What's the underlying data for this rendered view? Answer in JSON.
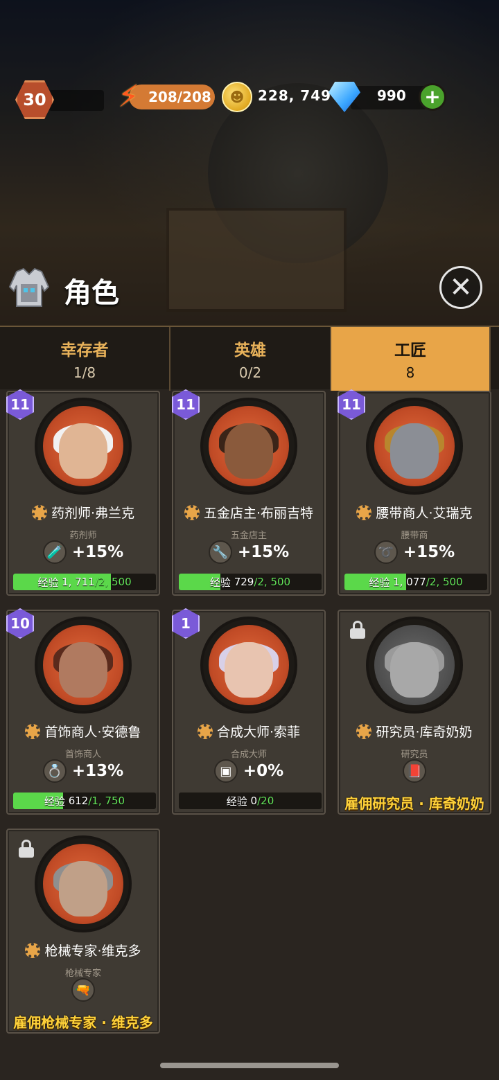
{
  "hud": {
    "player_level": "30",
    "energy": "208/208",
    "coins": "228, 749",
    "gems": "990",
    "add_label": "+"
  },
  "header": {
    "title": "角色",
    "close_label": "✕"
  },
  "tabs": [
    {
      "label": "幸存者",
      "count": "1/8",
      "active": false
    },
    {
      "label": "英雄",
      "count": "0/2",
      "active": false
    },
    {
      "label": "工匠",
      "count": "8",
      "active": true
    }
  ],
  "cards": [
    {
      "level": "11",
      "name": "药剂师·弗兰克",
      "role": "药剂师",
      "bonus": "+15%",
      "bonus_icon": "potion-icon",
      "xp_label": "经验",
      "xp_current": "1, 711",
      "xp_max": "2, 500",
      "xp_progress": 0.684,
      "locked": false
    },
    {
      "level": "11",
      "name": "五金店主·布丽吉特",
      "role": "五金店主",
      "bonus": "+15%",
      "bonus_icon": "wrench-icon",
      "xp_label": "经验",
      "xp_current": "729",
      "xp_max": "2, 500",
      "xp_progress": 0.292,
      "locked": false
    },
    {
      "level": "11",
      "name": "腰带商人·艾瑞克",
      "role": "腰带商",
      "bonus": "+15%",
      "bonus_icon": "belt-icon",
      "xp_label": "经验",
      "xp_current": "1, 077",
      "xp_max": "2, 500",
      "xp_progress": 0.431,
      "locked": false
    },
    {
      "level": "10",
      "name": "首饰商人·安德鲁",
      "role": "首饰商人",
      "bonus": "+13%",
      "bonus_icon": "ring-icon",
      "xp_label": "经验",
      "xp_current": "612",
      "xp_max": "1, 750",
      "xp_progress": 0.35,
      "locked": false
    },
    {
      "level": "1",
      "name": "合成大师·索菲",
      "role": "合成大师",
      "bonus": "+0%",
      "bonus_icon": "cube-icon",
      "xp_label": "经验",
      "xp_current": "0",
      "xp_max": "20",
      "xp_progress": 0,
      "locked": false
    },
    {
      "level": "",
      "name": "研究员·库奇奶奶",
      "role": "研究员",
      "bonus": "",
      "bonus_icon": "book-icon",
      "hire_label": "雇佣研究员 · 库奇奶奶",
      "locked": true
    },
    {
      "level": "",
      "name": "枪械专家·维克多",
      "role": "枪械专家",
      "bonus": "",
      "bonus_icon": "gun-icon",
      "hire_label": "雇佣枪械专家 · 维克多",
      "locked": true
    }
  ],
  "colors": {
    "accent": "#e8a548",
    "xp_green": "#5bd84a",
    "hire_gold": "#ffd23a",
    "level_purple": "#7a5ad8"
  }
}
